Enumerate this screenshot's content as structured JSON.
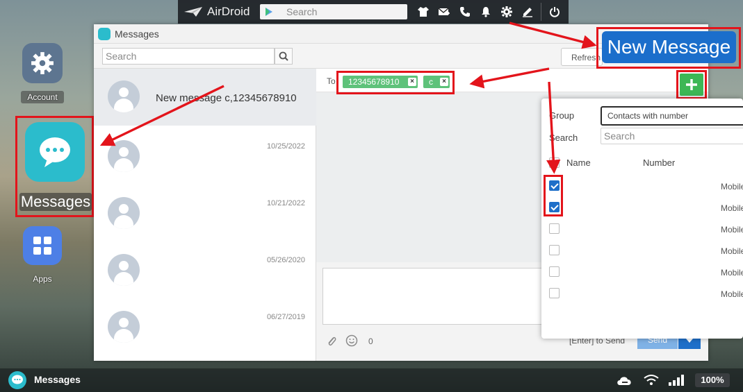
{
  "topbar": {
    "brand": "AirDroid",
    "search_placeholder": "Search",
    "icons": [
      "tshirt-icon",
      "mail-icon",
      "phone-icon",
      "bell-icon",
      "gear-icon",
      "pen-icon"
    ],
    "power_icon": "power-icon"
  },
  "desktop": {
    "account_label": "Account",
    "messages_label": "Messages",
    "apps_label": "Apps"
  },
  "window": {
    "title": "Messages",
    "search_placeholder": "Search",
    "refresh_label": "Refresh"
  },
  "conversations": [
    {
      "name": "New message c,12345678910",
      "date": ""
    },
    {
      "name": "",
      "date": "10/25/2022"
    },
    {
      "name": "",
      "date": "10/21/2022"
    },
    {
      "name": "",
      "date": "05/26/2020"
    },
    {
      "name": "",
      "date": "06/27/2019"
    }
  ],
  "compose": {
    "to_label": "To",
    "recipients": [
      "12345678910",
      "c"
    ],
    "char_count": "0",
    "enter_hint": "[Enter] to Send",
    "send_label": "Send"
  },
  "callout": {
    "new_message": "New Message"
  },
  "contacts_panel": {
    "group_label": "Group",
    "group_value": "Contacts with number",
    "search_label": "Search",
    "search_placeholder": "Search",
    "col_name": "Name",
    "col_number": "Number",
    "rows": [
      {
        "checked": true,
        "type": "Mobile"
      },
      {
        "checked": true,
        "type": "Mobile"
      },
      {
        "checked": false,
        "type": "Mobile"
      },
      {
        "checked": false,
        "type": "Mobile"
      },
      {
        "checked": false,
        "type": "Mobile"
      },
      {
        "checked": false,
        "type": "Mobile"
      }
    ]
  },
  "taskbar": {
    "app_label": "Messages",
    "battery": "100%"
  },
  "colors": {
    "highlight": "#e3141b",
    "accent_blue": "#1b6ecb",
    "chip_green": "#5ec27a",
    "messages_teal": "#2bbccc"
  }
}
